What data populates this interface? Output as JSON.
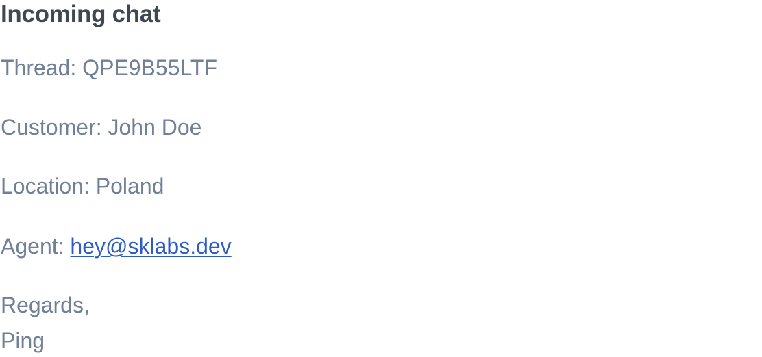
{
  "email": {
    "title": "Incoming chat",
    "thread_label": "Thread: ",
    "thread_id": "QPE9B55LTF",
    "customer_label": "Customer: ",
    "customer_name": "John Doe",
    "location_label": "Location: ",
    "location": "Poland",
    "agent_label": "Agent: ",
    "agent_email": "hey@sklabs.dev",
    "closing": "Regards,",
    "signature": "Ping"
  },
  "colors": {
    "heading": "#3d4852",
    "body_text": "#718096",
    "link": "#2d5cc7",
    "background": "#ffffff"
  }
}
